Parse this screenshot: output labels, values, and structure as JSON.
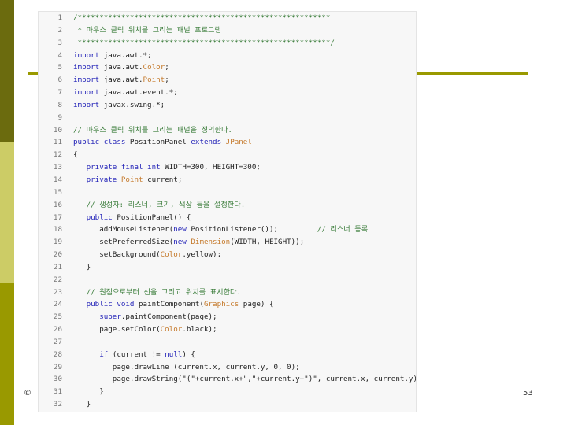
{
  "slide": {
    "footer_left": "©",
    "page_number": "53"
  },
  "code": {
    "lines": [
      {
        "num": "1",
        "segs": [
          {
            "c": "c",
            "t": "/**********************************************************"
          }
        ]
      },
      {
        "num": "2",
        "segs": [
          {
            "c": "c",
            "t": " * 마우스 클릭 위치를 그리는 패널 프로그램"
          }
        ]
      },
      {
        "num": "3",
        "segs": [
          {
            "c": "c",
            "t": " **********************************************************/"
          }
        ]
      },
      {
        "num": "4",
        "segs": [
          {
            "c": "k",
            "t": "import"
          },
          {
            "c": "n",
            "t": " java.awt.*;"
          }
        ]
      },
      {
        "num": "5",
        "segs": [
          {
            "c": "k",
            "t": "import"
          },
          {
            "c": "n",
            "t": " java.awt."
          },
          {
            "c": "t",
            "t": "Color"
          },
          {
            "c": "n",
            "t": ";"
          }
        ]
      },
      {
        "num": "6",
        "segs": [
          {
            "c": "k",
            "t": "import"
          },
          {
            "c": "n",
            "t": " java.awt."
          },
          {
            "c": "t",
            "t": "Point"
          },
          {
            "c": "n",
            "t": ";"
          }
        ]
      },
      {
        "num": "7",
        "segs": [
          {
            "c": "k",
            "t": "import"
          },
          {
            "c": "n",
            "t": " java.awt.event.*;"
          }
        ]
      },
      {
        "num": "8",
        "segs": [
          {
            "c": "k",
            "t": "import"
          },
          {
            "c": "n",
            "t": " javax.swing.*;"
          }
        ]
      },
      {
        "num": "9",
        "segs": []
      },
      {
        "num": "10",
        "segs": [
          {
            "c": "c",
            "t": "// 마우스 클릭 위치를 그리는 패널을 정의한다."
          }
        ]
      },
      {
        "num": "11",
        "segs": [
          {
            "c": "k",
            "t": "public class"
          },
          {
            "c": "n",
            "t": " PositionPanel "
          },
          {
            "c": "k",
            "t": "extends"
          },
          {
            "c": "n",
            "t": " "
          },
          {
            "c": "t",
            "t": "JPanel"
          }
        ]
      },
      {
        "num": "12",
        "segs": [
          {
            "c": "n",
            "t": "{"
          }
        ]
      },
      {
        "num": "13",
        "segs": [
          {
            "c": "n",
            "t": "   "
          },
          {
            "c": "k",
            "t": "private final int"
          },
          {
            "c": "n",
            "t": " WIDTH=300, HEIGHT=300;"
          }
        ]
      },
      {
        "num": "14",
        "segs": [
          {
            "c": "n",
            "t": "   "
          },
          {
            "c": "k",
            "t": "private"
          },
          {
            "c": "n",
            "t": " "
          },
          {
            "c": "t",
            "t": "Point"
          },
          {
            "c": "n",
            "t": " current;"
          }
        ]
      },
      {
        "num": "15",
        "segs": []
      },
      {
        "num": "16",
        "segs": [
          {
            "c": "n",
            "t": "   "
          },
          {
            "c": "c",
            "t": "// 생성자: 리스너, 크기, 색상 등을 설정한다."
          }
        ]
      },
      {
        "num": "17",
        "segs": [
          {
            "c": "n",
            "t": "   "
          },
          {
            "c": "k",
            "t": "public"
          },
          {
            "c": "n",
            "t": " PositionPanel() {"
          }
        ]
      },
      {
        "num": "18",
        "segs": [
          {
            "c": "n",
            "t": "      addMouseListener("
          },
          {
            "c": "k",
            "t": "new"
          },
          {
            "c": "n",
            "t": " PositionListener());         "
          },
          {
            "c": "c",
            "t": "// 리스너 등록"
          }
        ]
      },
      {
        "num": "19",
        "segs": [
          {
            "c": "n",
            "t": "      setPreferredSize("
          },
          {
            "c": "k",
            "t": "new"
          },
          {
            "c": "n",
            "t": " "
          },
          {
            "c": "t",
            "t": "Dimension"
          },
          {
            "c": "n",
            "t": "(WIDTH, HEIGHT));"
          }
        ]
      },
      {
        "num": "20",
        "segs": [
          {
            "c": "n",
            "t": "      setBackground("
          },
          {
            "c": "t",
            "t": "Color"
          },
          {
            "c": "n",
            "t": ".yellow);"
          }
        ]
      },
      {
        "num": "21",
        "segs": [
          {
            "c": "n",
            "t": "   }"
          }
        ]
      },
      {
        "num": "22",
        "segs": []
      },
      {
        "num": "23",
        "segs": [
          {
            "c": "n",
            "t": "   "
          },
          {
            "c": "c",
            "t": "// 원점으로부터 선을 그리고 위치를 표시한다."
          }
        ]
      },
      {
        "num": "24",
        "segs": [
          {
            "c": "n",
            "t": "   "
          },
          {
            "c": "k",
            "t": "public void"
          },
          {
            "c": "n",
            "t": " paintComponent("
          },
          {
            "c": "t",
            "t": "Graphics"
          },
          {
            "c": "n",
            "t": " page) {"
          }
        ]
      },
      {
        "num": "25",
        "segs": [
          {
            "c": "n",
            "t": "      "
          },
          {
            "c": "k",
            "t": "super"
          },
          {
            "c": "n",
            "t": ".paintComponent(page);"
          }
        ]
      },
      {
        "num": "26",
        "segs": [
          {
            "c": "n",
            "t": "      page.setColor("
          },
          {
            "c": "t",
            "t": "Color"
          },
          {
            "c": "n",
            "t": ".black);"
          }
        ]
      },
      {
        "num": "27",
        "segs": []
      },
      {
        "num": "28",
        "segs": [
          {
            "c": "n",
            "t": "      "
          },
          {
            "c": "k",
            "t": "if"
          },
          {
            "c": "n",
            "t": " (current != "
          },
          {
            "c": "k",
            "t": "null"
          },
          {
            "c": "n",
            "t": ") {"
          }
        ]
      },
      {
        "num": "29",
        "segs": [
          {
            "c": "n",
            "t": "         page.drawLine (current.x, current.y, 0, 0);"
          }
        ]
      },
      {
        "num": "30",
        "segs": [
          {
            "c": "n",
            "t": "         page.drawString(\"(\"+current.x+\",\"+current.y+\")\", current.x, current.y);"
          }
        ]
      },
      {
        "num": "31",
        "segs": [
          {
            "c": "n",
            "t": "      }"
          }
        ]
      },
      {
        "num": "32",
        "segs": [
          {
            "c": "n",
            "t": "   }"
          }
        ]
      }
    ]
  }
}
